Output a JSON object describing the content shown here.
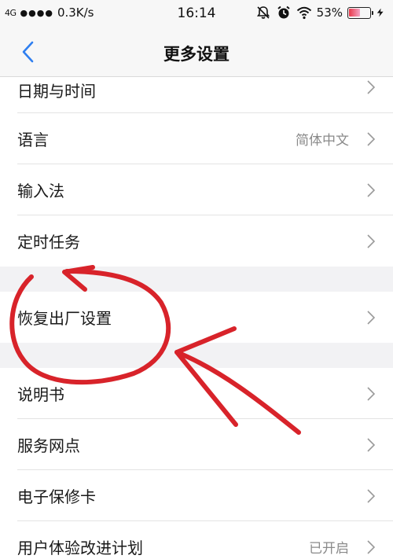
{
  "status_bar": {
    "network": "4G",
    "speed": "0.3K/s",
    "time": "16:14",
    "battery": "53%",
    "battery_level": 0.53,
    "icons": [
      "mute-icon",
      "alarm-icon",
      "wifi-icon",
      "battery-icon",
      "charging-icon"
    ]
  },
  "nav": {
    "title": "更多设置",
    "back_icon": "chevron-left-icon",
    "accent": "#2f7ff0"
  },
  "settings": {
    "date_time": "日期与时间",
    "language": "语言",
    "language_value": "简体中文",
    "input_method": "输入法",
    "scheduled_tasks": "定时任务",
    "factory_reset": "恢复出厂设置",
    "manual": "说明书",
    "service_outlets": "服务网点",
    "e_warranty": "电子保修卡",
    "ux_program": "用户体验改进计划",
    "ux_program_value": "已开启"
  },
  "annotation_color": "#d8232a"
}
